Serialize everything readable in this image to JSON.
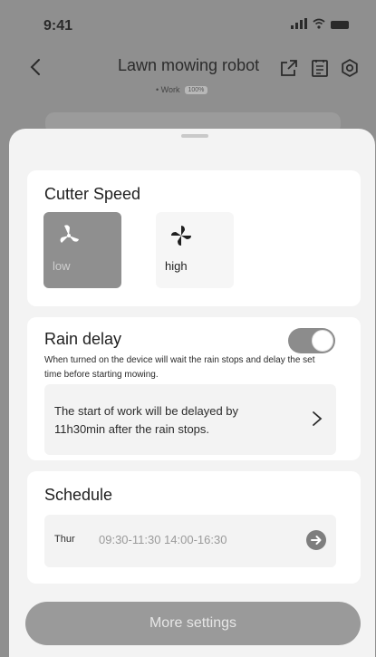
{
  "status_bar": {
    "time": "9:41"
  },
  "header": {
    "title": "Lawn mowing robot",
    "status": "• Work",
    "battery_badge": "100%"
  },
  "cutter_speed": {
    "title": "Cutter Speed",
    "options": [
      {
        "label": "low",
        "selected": true
      },
      {
        "label": "high",
        "selected": false
      }
    ]
  },
  "rain_delay": {
    "title": "Rain delay",
    "enabled": true,
    "description": "When turned on the device will wait the rain stops and delay the set time before starting mowing.",
    "delay_text": "The start of work will be delayed by 11h30min after the rain stops."
  },
  "schedule": {
    "title": "Schedule",
    "day": "Thur",
    "times": "09:30-11:30  14:00-16:30"
  },
  "more_settings_label": "More settings"
}
